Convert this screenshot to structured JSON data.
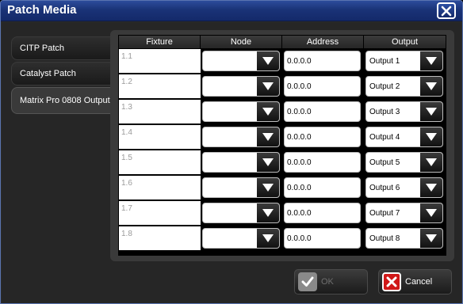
{
  "window": {
    "title": "Patch Media"
  },
  "tabs": [
    {
      "label": "CITP Patch"
    },
    {
      "label": "Catalyst Patch"
    },
    {
      "label": "Matrix Pro 0808 Output",
      "active": true
    }
  ],
  "table": {
    "columns": [
      "Fixture",
      "Node",
      "Address",
      "Output"
    ],
    "rows": [
      {
        "fixture": "1.1",
        "node": "",
        "address": "0.0.0.0",
        "output": "Output 1"
      },
      {
        "fixture": "1.2",
        "node": "",
        "address": "0.0.0.0",
        "output": "Output 2"
      },
      {
        "fixture": "1.3",
        "node": "",
        "address": "0.0.0.0",
        "output": "Output 3"
      },
      {
        "fixture": "1.4",
        "node": "",
        "address": "0.0.0.0",
        "output": "Output 4"
      },
      {
        "fixture": "1.5",
        "node": "",
        "address": "0.0.0.0",
        "output": "Output 5"
      },
      {
        "fixture": "1.6",
        "node": "",
        "address": "0.0.0.0",
        "output": "Output 6"
      },
      {
        "fixture": "1.7",
        "node": "",
        "address": "0.0.0.0",
        "output": "Output 7"
      },
      {
        "fixture": "1.8",
        "node": "",
        "address": "0.0.0.0",
        "output": "Output 8"
      }
    ]
  },
  "buttons": {
    "ok": {
      "label": "OK",
      "enabled": false,
      "icon": "check-icon"
    },
    "cancel": {
      "label": "Cancel",
      "enabled": true,
      "icon": "x-icon"
    }
  },
  "colors": {
    "title_bar": "#1a3377",
    "cancel_icon": "#d01818",
    "ok_disabled_text": "#6e6e6e"
  }
}
